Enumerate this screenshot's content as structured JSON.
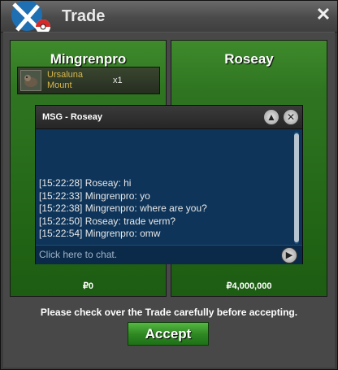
{
  "window": {
    "title": "Trade",
    "close_icon": "close-icon"
  },
  "left_panel": {
    "player": "Mingrenpro",
    "items": [
      {
        "name": "Ursaluna Mount",
        "qty": "x1"
      }
    ],
    "money": "₽0"
  },
  "right_panel": {
    "player": "Roseay",
    "money": "₽4,000,000"
  },
  "notice": "Please check over the Trade carefully before accepting.",
  "accept_label": "Accept",
  "msg": {
    "title": "MSG - Roseay",
    "lines": [
      "[15:22:28] Roseay: hi",
      "[15:22:33] Mingrenpro: yo",
      "[15:22:38] Mingrenpro: where are you?",
      "[15:22:50] Roseay: trade verm?",
      "[15:22:54] Mingrenpro: omw"
    ],
    "chat_placeholder": "Click here to chat."
  },
  "colors": {
    "panel_green": "#2f7521",
    "item_text": "#d9b74a",
    "chat_bg": "#0e3459"
  }
}
